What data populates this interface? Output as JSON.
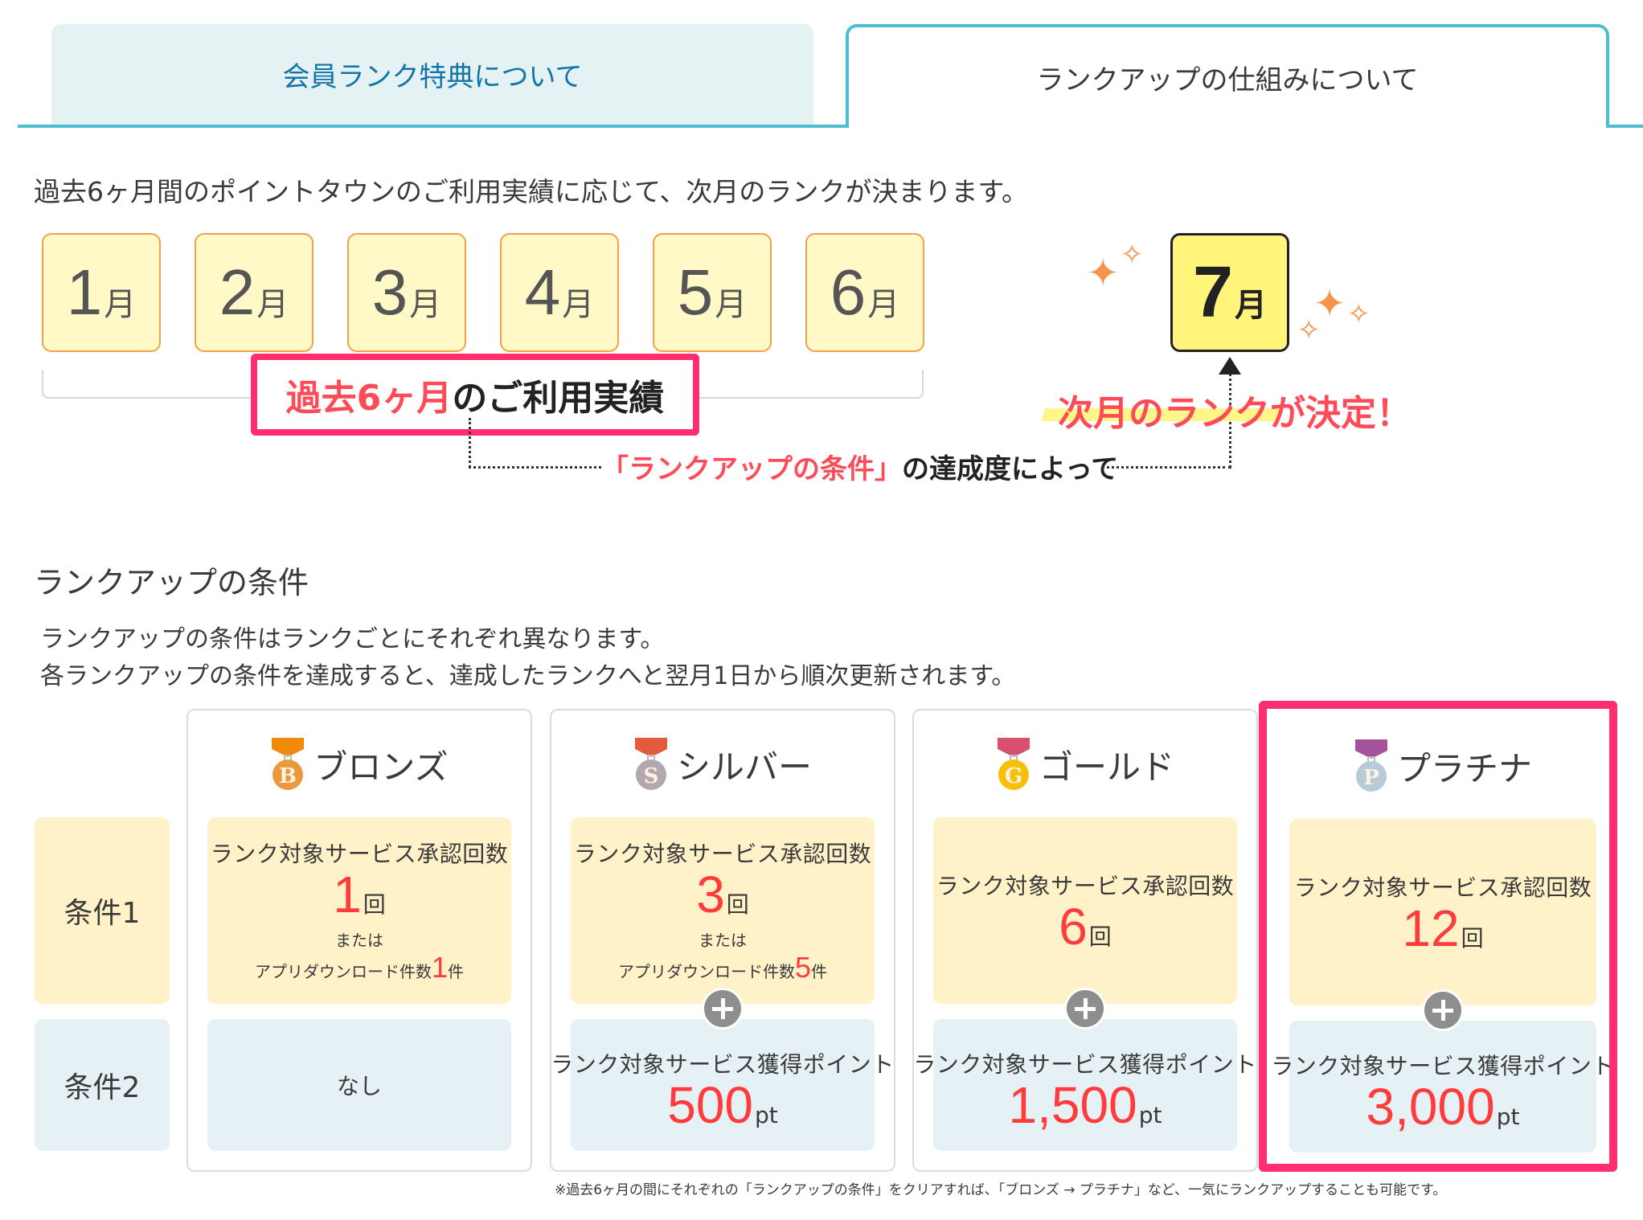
{
  "tabs": [
    {
      "label": "会員ランク特典について",
      "active": false
    },
    {
      "label": "ランクアップの仕組みについて",
      "active": true
    }
  ],
  "intro": "過去6ヶ月間のポイントタウンのご利用実績に応じて、次月のランクが決まります。",
  "months": [
    {
      "num": "1",
      "unit": "月"
    },
    {
      "num": "2",
      "unit": "月"
    },
    {
      "num": "3",
      "unit": "月"
    },
    {
      "num": "4",
      "unit": "月"
    },
    {
      "num": "5",
      "unit": "月"
    },
    {
      "num": "6",
      "unit": "月"
    }
  ],
  "next_month": {
    "num": "7",
    "unit": "月"
  },
  "past_label": {
    "highlight": "過去6ヶ月",
    "rest": "のご利用実績"
  },
  "connector": {
    "highlight": "「ランクアップの条件」",
    "rest": "の達成度によって"
  },
  "decided_label": "次月のランクが決定！",
  "conditions": {
    "title": "ランクアップの条件",
    "desc_lines": [
      "ランクアップの条件はランクごとにそれぞれ異なります。",
      "各ランクアップの条件を達成すると、達成したランクへと翌月1日から順次更新されます。"
    ],
    "row_labels": [
      "条件1",
      "条件2"
    ],
    "approval_label": "ランク対象サービス承認回数",
    "approval_unit": "回",
    "or_label": "または",
    "app_label": "アプリダウンロード件数",
    "app_unit": "件",
    "points_label": "ランク対象サービス獲得ポイント",
    "points_unit": "pt",
    "none_label": "なし",
    "ranks": [
      {
        "name": "ブロンズ",
        "letter": "B",
        "ribbon": "#ef8a0b",
        "medal": "#e89a3c",
        "approvals": "1",
        "apps": "1",
        "points": null
      },
      {
        "name": "シルバー",
        "letter": "S",
        "ribbon": "#e45a3c",
        "medal": "#b3a7b0",
        "approvals": "3",
        "apps": "5",
        "points": "500"
      },
      {
        "name": "ゴールド",
        "letter": "G",
        "ribbon": "#d9506e",
        "medal": "#f5c007",
        "approvals": "6",
        "apps": null,
        "points": "1,500"
      },
      {
        "name": "プラチナ",
        "letter": "P",
        "ribbon": "#a45299",
        "medal": "#b7cbd6",
        "approvals": "12",
        "apps": null,
        "points": "3,000",
        "highlighted": true
      }
    ],
    "footnote": "※過去6ヶ月の間にそれぞれの「ランクアップの条件」をクリアすれば、「ブロンズ → プラチナ」など、一気にランクアップすることも可能です。"
  },
  "colors": {
    "accent_teal": "#4dbdd0",
    "highlight_pink": "#ff2e6e",
    "value_red": "#ff3b3b",
    "month_bg": "#fff9c7",
    "month_border": "#f3a04a",
    "next_month_bg": "#fff57a",
    "cond1_bg": "#fff1c8",
    "cond2_bg": "#e5f1f4"
  }
}
